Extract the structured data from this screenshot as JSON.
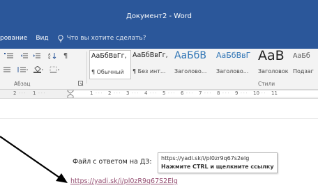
{
  "window": {
    "title": "Документ2 - Word",
    "accent": "#2b579a"
  },
  "menu": {
    "items": [
      "рование",
      "Вид"
    ],
    "tell_me": "Что вы хотите сделать?"
  },
  "ribbon": {
    "paragraph_group_label": "Абзац",
    "styles_group_label": "Стили",
    "styles": [
      {
        "sample": "АаБбВвГг,",
        "name": "¶ Обычный",
        "selected": true
      },
      {
        "sample": "АаБбВвГг,",
        "name": "¶ Без инт..."
      },
      {
        "sample": "АаБбВ",
        "name": "Заголово..."
      },
      {
        "sample": "АаБбВвГ",
        "name": "Заголово..."
      },
      {
        "sample": "АаВ",
        "name": "Заголовок"
      },
      {
        "sample": "АаБб",
        "name": "Подзаг"
      }
    ]
  },
  "ruler": {
    "numbers": [
      "2",
      "1",
      "1",
      "2",
      "3",
      "4",
      "5",
      "6",
      "7",
      "8",
      "9",
      "10",
      "11"
    ]
  },
  "document": {
    "label": "Файл с ответом на ДЗ:",
    "link_text": "https://yadi.sk/i/pl0zR9q67S2Elg",
    "link_color": "#954f72"
  },
  "tooltip": {
    "url": "https://yadi.sk/i/pl0zr9q67s2elg",
    "hint": "Нажмите CTRL и щелкните ссылку"
  }
}
